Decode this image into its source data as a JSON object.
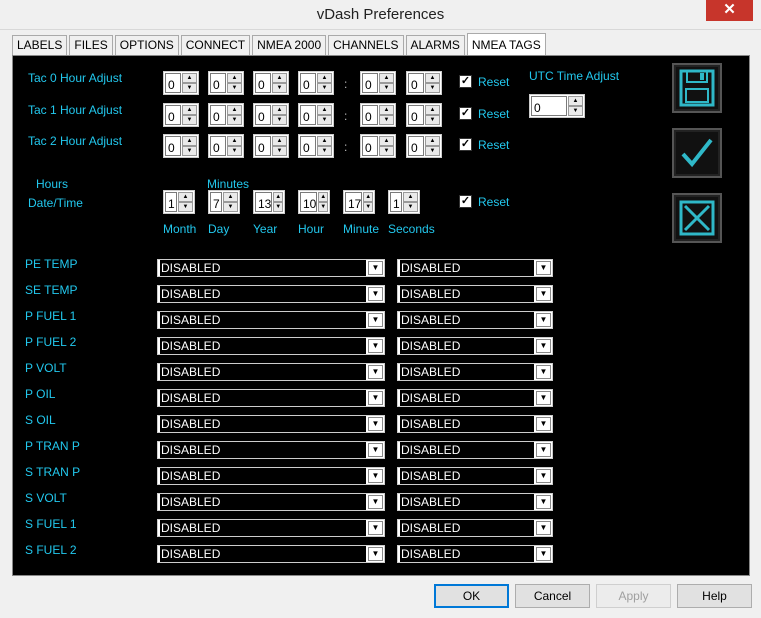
{
  "window": {
    "title": "vDash Preferences",
    "close_glyph": "✕"
  },
  "tabs": [
    "LABELS",
    "FILES",
    "OPTIONS",
    "CONNECT",
    "NMEA 2000",
    "CHANNELS",
    "ALARMS",
    "NMEA TAGS"
  ],
  "active_tab": "NMEA TAGS",
  "tac_rows": [
    {
      "label": "Tac 0 Hour Adjust",
      "values": [
        "0",
        "0",
        "0",
        "0",
        "0",
        "0"
      ],
      "reset": "Reset"
    },
    {
      "label": "Tac 1 Hour Adjust",
      "values": [
        "0",
        "0",
        "0",
        "0",
        "0",
        "0"
      ],
      "reset": "Reset"
    },
    {
      "label": "Tac 2 Hour Adjust",
      "values": [
        "0",
        "0",
        "0",
        "0",
        "0",
        "0"
      ],
      "reset": "Reset"
    }
  ],
  "colon": ":",
  "hours_label": "Hours",
  "minutes_label": "Minutes",
  "utc": {
    "label": "UTC Time Adjust",
    "value": "0"
  },
  "datetime": {
    "label": "Date/Time",
    "values": [
      "1",
      "7",
      "13",
      "10",
      "17",
      "1"
    ],
    "units": [
      "Month",
      "Day",
      "Year",
      "Hour",
      "Minute",
      "Seconds"
    ],
    "reset": "Reset"
  },
  "spin_glyphs": {
    "up": "▲",
    "down": "▼",
    "dropdown": "▼",
    "check": "✓"
  },
  "tags": [
    {
      "label": "PE TEMP",
      "left": "DISABLED",
      "right": "DISABLED"
    },
    {
      "label": "SE TEMP",
      "left": "DISABLED",
      "right": "DISABLED"
    },
    {
      "label": "P FUEL 1",
      "left": "DISABLED",
      "right": "DISABLED"
    },
    {
      "label": "P FUEL 2",
      "left": "DISABLED",
      "right": "DISABLED"
    },
    {
      "label": "P VOLT",
      "left": "DISABLED",
      "right": "DISABLED"
    },
    {
      "label": "P OIL",
      "left": "DISABLED",
      "right": "DISABLED"
    },
    {
      "label": "S OIL",
      "left": "DISABLED",
      "right": "DISABLED"
    },
    {
      "label": "P TRAN P",
      "left": "DISABLED",
      "right": "DISABLED"
    },
    {
      "label": "S TRAN P",
      "left": "DISABLED",
      "right": "DISABLED"
    },
    {
      "label": "S VOLT",
      "left": "DISABLED",
      "right": "DISABLED"
    },
    {
      "label": "S FUEL 1",
      "left": "DISABLED",
      "right": "DISABLED"
    },
    {
      "label": "S FUEL 2",
      "left": "DISABLED",
      "right": "DISABLED"
    }
  ],
  "side_buttons": [
    "save-icon",
    "checkmark-icon",
    "cancel-x-icon"
  ],
  "footer": {
    "ok": "OK",
    "cancel": "Cancel",
    "apply": "Apply",
    "help": "Help"
  },
  "colors": {
    "label": "#22c8ee",
    "panel": "#000000",
    "icon_teal": "#2fb8c8"
  }
}
